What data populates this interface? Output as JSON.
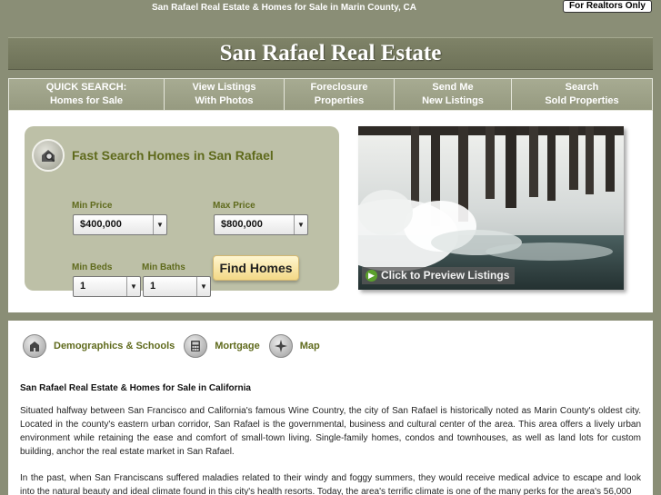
{
  "header": {
    "tagline": "San Rafael Real Estate & Homes for Sale in Marin County, CA",
    "realtors_button": "For Realtors Only"
  },
  "title": "San Rafael Real Estate",
  "nav": {
    "items": [
      {
        "line1": "QUICK SEARCH:",
        "line2": "Homes for Sale"
      },
      {
        "line1": "View Listings",
        "line2": "With Photos"
      },
      {
        "line1": "Foreclosure",
        "line2": "Properties"
      },
      {
        "line1": "Send Me",
        "line2": "New Listings"
      },
      {
        "line1": "Search",
        "line2": "Sold Properties"
      }
    ]
  },
  "search": {
    "icon": "home-search-icon",
    "title": "Fast Search Homes in San Rafael",
    "min_price_label": "Min Price",
    "min_price_value": "$400,000",
    "max_price_label": "Max Price",
    "max_price_value": "$800,000",
    "min_beds_label": "Min Beds",
    "min_beds_value": "1",
    "min_baths_label": "Min Baths",
    "min_baths_value": "1",
    "button": "Find Homes"
  },
  "photo": {
    "caption": "Click to Preview Listings"
  },
  "links": [
    {
      "icon": "school-icon",
      "label": "Demographics & Schools"
    },
    {
      "icon": "calculator-icon",
      "label": "Mortgage"
    },
    {
      "icon": "compass-icon",
      "label": "Map"
    }
  ],
  "article": {
    "heading": "San Rafael Real Estate & Homes for Sale in California",
    "paragraph1": "Situated halfway between San Francisco and California's famous Wine Country, the city of San Rafael is historically noted as Marin County's oldest city. Located in the county's eastern urban corridor, San Rafael is the governmental, business and cultural center of the area. This area offers a lively urban environment while retaining the ease and comfort of small-town living. Single-family homes, condos and townhouses, as well as land lots for custom building, anchor the real estate market in San Rafael.",
    "paragraph2": "In the past, when San Franciscans suffered maladies related to their windy and foggy summers, they would receive medical advice to escape and look into the natural beauty and ideal climate found in this city's health resorts. Today, the area's terrific climate is one of the many perks for the area's 56,000"
  },
  "colors": {
    "background": "#8a8e76",
    "accent_text": "#5f6a1c",
    "search_panel": "#bdc0a7",
    "button_gold": "#f3d886"
  }
}
